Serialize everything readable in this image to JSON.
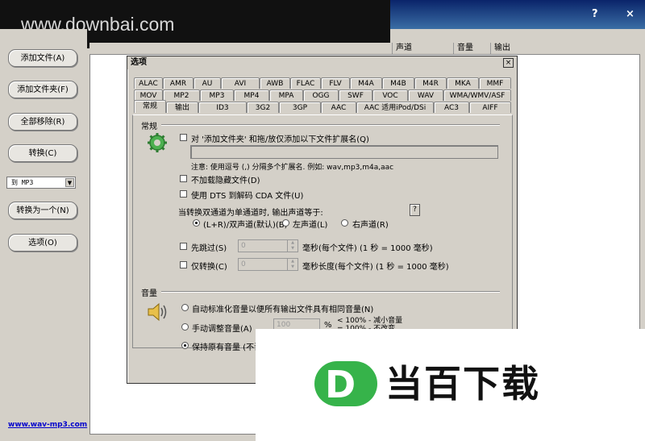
{
  "window": {
    "watermark": "www.downbai.com",
    "help_btn": "?",
    "close_btn": "×"
  },
  "left_panel": {
    "buttons": [
      "添加文件(A)",
      "添加文件夹(F)",
      "全部移除(R)",
      "转换(C)",
      "转换为一个(N)",
      "选项(O)"
    ],
    "format_select": "到 MP3",
    "site_link": "www.wav-mp3.com"
  },
  "list": {
    "columns": [
      "声道",
      "音量",
      "输出"
    ]
  },
  "dialog": {
    "title": "选项",
    "close": "×",
    "tabs_row1": [
      "ALAC",
      "AMR",
      "AU",
      "AVI",
      "AWB",
      "FLAC",
      "FLV",
      "M4A",
      "M4B",
      "M4R",
      "MKA",
      "MMF"
    ],
    "tabs_row2": [
      "MOV",
      "MP2",
      "MP3",
      "MP4",
      "MPA",
      "OGG",
      "SWF",
      "VOC",
      "WAV",
      "WMA/WMV/ASF"
    ],
    "tabs_row3": [
      "常规",
      "输出",
      "ID3",
      "3G2",
      "3GP",
      "AAC",
      "AAC 适用iPod/DSi",
      "AC3",
      "AIFF"
    ],
    "general": {
      "heading": "常规",
      "opt_ext": "对 '添加文件夹' 和拖/放仅添加以下文件扩展名(Q)",
      "ext_value": "",
      "note": "注意: 使用逗号 (,) 分隔多个扩展名. 例如: wav,mp3,m4a,aac",
      "opt_hidden": "不加载隐藏文件(D)",
      "opt_dts": "使用 DTS 到解码 CDA 文件(U)",
      "mono_label": "当转换双通道为单通道时, 输出声道等于:",
      "help_btn": "?",
      "radio_both": "(L+R)/双声道(默认)(B)",
      "radio_left": "左声道(L)",
      "radio_right": "右声道(R)",
      "opt_skip": "先跳过(S)",
      "skip_value": "0",
      "skip_unit": "毫秒(每个文件) (1 秒 = 1000 毫秒)",
      "opt_only": "仅转换(C)",
      "only_value": "0",
      "only_unit": "毫秒长度(每个文件) (1 秒 = 1000 毫秒)"
    },
    "volume": {
      "heading": "音量",
      "radio_auto": "自动标准化音量以便所有输出文件具有相同音量(N)",
      "radio_manual": "手动调整音量(A)",
      "manual_value": "100",
      "percent": "%",
      "hint1": "< 100% - 减小音量",
      "hint2": "= 100% - 不改变",
      "radio_keep": "保持原有音量 (不调"
    }
  },
  "overlay": {
    "logo_letter": "D",
    "logo_text": "当百下载"
  },
  "colors": {
    "title_bar": "#0a246a",
    "logo_green": "#36b34a",
    "link": "#0000cc"
  }
}
